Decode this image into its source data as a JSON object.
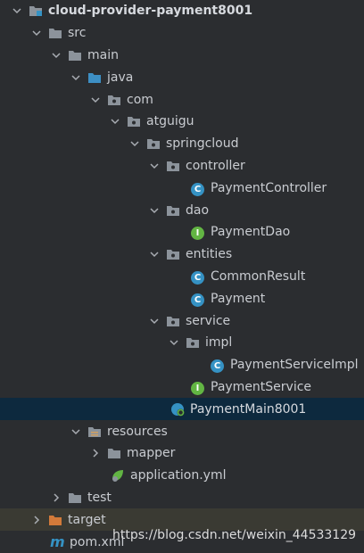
{
  "tree": {
    "rows": [
      {
        "label": "cloud-provider-payment8001",
        "icon": "module-folder-icon",
        "expanded": true
      },
      {
        "label": "src",
        "icon": "folder-icon",
        "expanded": true
      },
      {
        "label": "main",
        "icon": "folder-icon",
        "expanded": true
      },
      {
        "label": "java",
        "icon": "source-folder-icon",
        "expanded": true
      },
      {
        "label": "com",
        "icon": "package-icon",
        "expanded": true
      },
      {
        "label": "atguigu",
        "icon": "package-icon",
        "expanded": true
      },
      {
        "label": "springcloud",
        "icon": "package-icon",
        "expanded": true
      },
      {
        "label": "controller",
        "icon": "package-icon",
        "expanded": true
      },
      {
        "label": "PaymentController",
        "icon": "class-icon"
      },
      {
        "label": "dao",
        "icon": "package-icon",
        "expanded": true
      },
      {
        "label": "PaymentDao",
        "icon": "interface-icon"
      },
      {
        "label": "entities",
        "icon": "package-icon",
        "expanded": true
      },
      {
        "label": "CommonResult",
        "icon": "class-icon"
      },
      {
        "label": "Payment",
        "icon": "class-icon"
      },
      {
        "label": "service",
        "icon": "package-icon",
        "expanded": true
      },
      {
        "label": "impl",
        "icon": "package-icon",
        "expanded": true
      },
      {
        "label": "PaymentServiceImpl",
        "icon": "class-icon"
      },
      {
        "label": "PaymentService",
        "icon": "interface-icon"
      },
      {
        "label": "PaymentMain8001",
        "icon": "spring-boot-class-icon",
        "selected": true
      },
      {
        "label": "resources",
        "icon": "resources-folder-icon",
        "expanded": true
      },
      {
        "label": "mapper",
        "icon": "folder-icon",
        "expanded": false
      },
      {
        "label": "application.yml",
        "icon": "spring-config-icon"
      },
      {
        "label": "test",
        "icon": "folder-icon",
        "expanded": false
      },
      {
        "label": "target",
        "icon": "excluded-folder-icon",
        "expanded": false
      },
      {
        "label": "pom.xml",
        "icon": "maven-icon"
      }
    ]
  },
  "watermark": "https://blog.csdn.net/weixin_44533129",
  "colors": {
    "background": "#2b2d30",
    "selection": "#0d293e",
    "class_icon": "#3592c4",
    "interface_icon": "#62b543",
    "excluded_folder": "#d27a3a"
  },
  "icon_glyphs": {
    "class": "C",
    "interface": "I",
    "maven": "m"
  }
}
